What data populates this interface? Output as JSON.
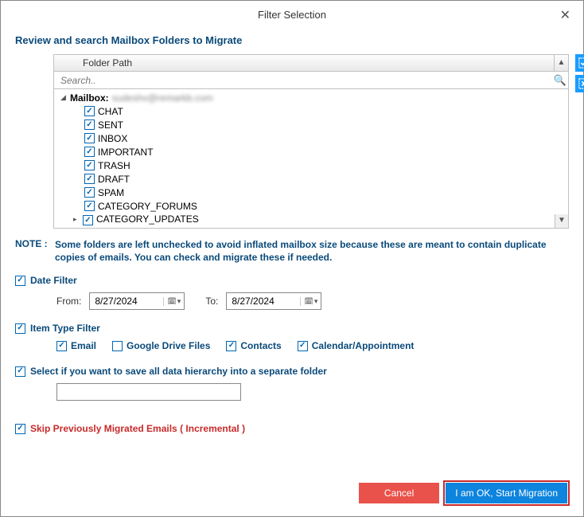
{
  "window": {
    "title": "Filter Selection"
  },
  "header": {
    "review_label": "Review and search Mailbox Folders to Migrate"
  },
  "folder_tree": {
    "column_header": "Folder Path",
    "search_placeholder": "Search..",
    "root_label": "Mailbox:",
    "root_account": "sudeshv@remarkb.com",
    "items": [
      {
        "label": "CHAT",
        "checked": true
      },
      {
        "label": "SENT",
        "checked": true
      },
      {
        "label": "INBOX",
        "checked": true
      },
      {
        "label": "IMPORTANT",
        "checked": true
      },
      {
        "label": "TRASH",
        "checked": true
      },
      {
        "label": "DRAFT",
        "checked": true
      },
      {
        "label": "SPAM",
        "checked": true
      },
      {
        "label": "CATEGORY_FORUMS",
        "checked": true
      },
      {
        "label": "CATEGORY_UPDATES",
        "checked": true,
        "selected": true,
        "has_children": true
      }
    ]
  },
  "note": {
    "label": "NOTE :",
    "text": "Some folders are left unchecked to avoid inflated mailbox size because these are meant to contain duplicate copies of emails. You can check and migrate these if needed."
  },
  "date_filter": {
    "label": "Date Filter",
    "checked": true,
    "from_label": "From:",
    "from_value": "8/27/2024",
    "to_label": "To:",
    "to_value": "8/27/2024"
  },
  "item_type_filter": {
    "label": "Item Type Filter",
    "checked": true,
    "types": [
      {
        "label": "Email",
        "checked": true
      },
      {
        "label": "Google Drive Files",
        "checked": false
      },
      {
        "label": "Contacts",
        "checked": true
      },
      {
        "label": "Calendar/Appointment",
        "checked": true
      }
    ]
  },
  "hierarchy": {
    "label": "Select if you want to save all data hierarchy into a separate folder",
    "checked": true,
    "value": ""
  },
  "skip": {
    "label": "Skip Previously Migrated Emails ( Incremental )",
    "checked": true
  },
  "footer": {
    "cancel": "Cancel",
    "ok": "I am OK, Start Migration"
  }
}
